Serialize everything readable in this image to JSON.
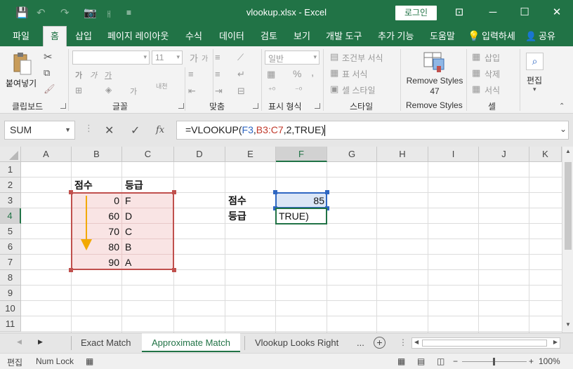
{
  "window": {
    "title": "vlookup.xlsx  -  Excel",
    "login_label": "로그인",
    "min_glyph": "─",
    "max_glyph": "☐",
    "close_glyph": "✕",
    "ribbon_display_glyph": "⊡"
  },
  "quick_access": {
    "save_glyph": "💾",
    "undo_glyph": "↶",
    "redo_glyph": "↷",
    "camera_glyph": "📷",
    "text_glyph": "ㅐ",
    "customize_glyph": "≡"
  },
  "ribbon_tabs": [
    "파일",
    "홈",
    "삽입",
    "페이지 레이아웃",
    "수식",
    "데이터",
    "검토",
    "보기",
    "개발 도구",
    "추가 기능",
    "도움말",
    "입력하세",
    "공유"
  ],
  "ribbon": {
    "clipboard": {
      "paste_label": "붙여넣기",
      "group_label": "클립보드"
    },
    "font": {
      "size_value": "11",
      "group_label": "글꼴",
      "bold": "가",
      "italic": "가",
      "underline": "가",
      "grow": "가",
      "shrink": "가",
      "char_case": "내천"
    },
    "alignment": {
      "group_label": "맞춤"
    },
    "number": {
      "format_value": "일반",
      "percent": "%",
      "comma": ",",
      "group_label": "표시 형식"
    },
    "styles": {
      "cond_format": "조건부 서식",
      "table_format": "표 서식",
      "cell_styles": "셀 스타일",
      "group_label": "스타일"
    },
    "remove_styles": {
      "line1": "Remove Styles",
      "line2": "47",
      "group_label": "Remove Styles"
    },
    "cells": {
      "insert": "삽입",
      "delete": "삭제",
      "format": "서식",
      "group_label": "셀"
    },
    "editing": {
      "label": "편집"
    }
  },
  "formula_bar": {
    "name_box": "SUM",
    "cancel_glyph": "✕",
    "enter_glyph": "✓",
    "fx_label": "fx",
    "formula_prefix": "=VLOOKUP(",
    "ref1": "F3",
    "comma1": ",",
    "ref2": "B3:C7",
    "formula_suffix": ",2,TRUE)"
  },
  "columns": [
    "A",
    "B",
    "C",
    "D",
    "E",
    "F",
    "G",
    "H",
    "I",
    "J",
    "K"
  ],
  "rows": [
    "1",
    "2",
    "3",
    "4",
    "5",
    "6",
    "7",
    "8",
    "9",
    "10",
    "11"
  ],
  "cells": {
    "B2": "점수",
    "C2": "등급",
    "B3": "0",
    "C3": "F",
    "B4": "60",
    "C4": "D",
    "B5": "70",
    "C5": "C",
    "B6": "80",
    "C6": "B",
    "B7": "90",
    "C7": "A",
    "E3": "점수",
    "F3": "85",
    "E4": "등급",
    "F4": "TRUE)"
  },
  "sheet_tabs": [
    "Exact Match",
    "Approximate Match",
    "Vlookup Looks Right"
  ],
  "sheet_more": "...",
  "status": {
    "mode": "편집",
    "num_lock": "Num Lock",
    "zoom": "100%"
  },
  "colors": {
    "accent": "#217346",
    "range_red": "#c0504d",
    "range_fill": "#f9e4e4",
    "range_blue": "#2f67c2",
    "arrow": "#f2a900"
  }
}
